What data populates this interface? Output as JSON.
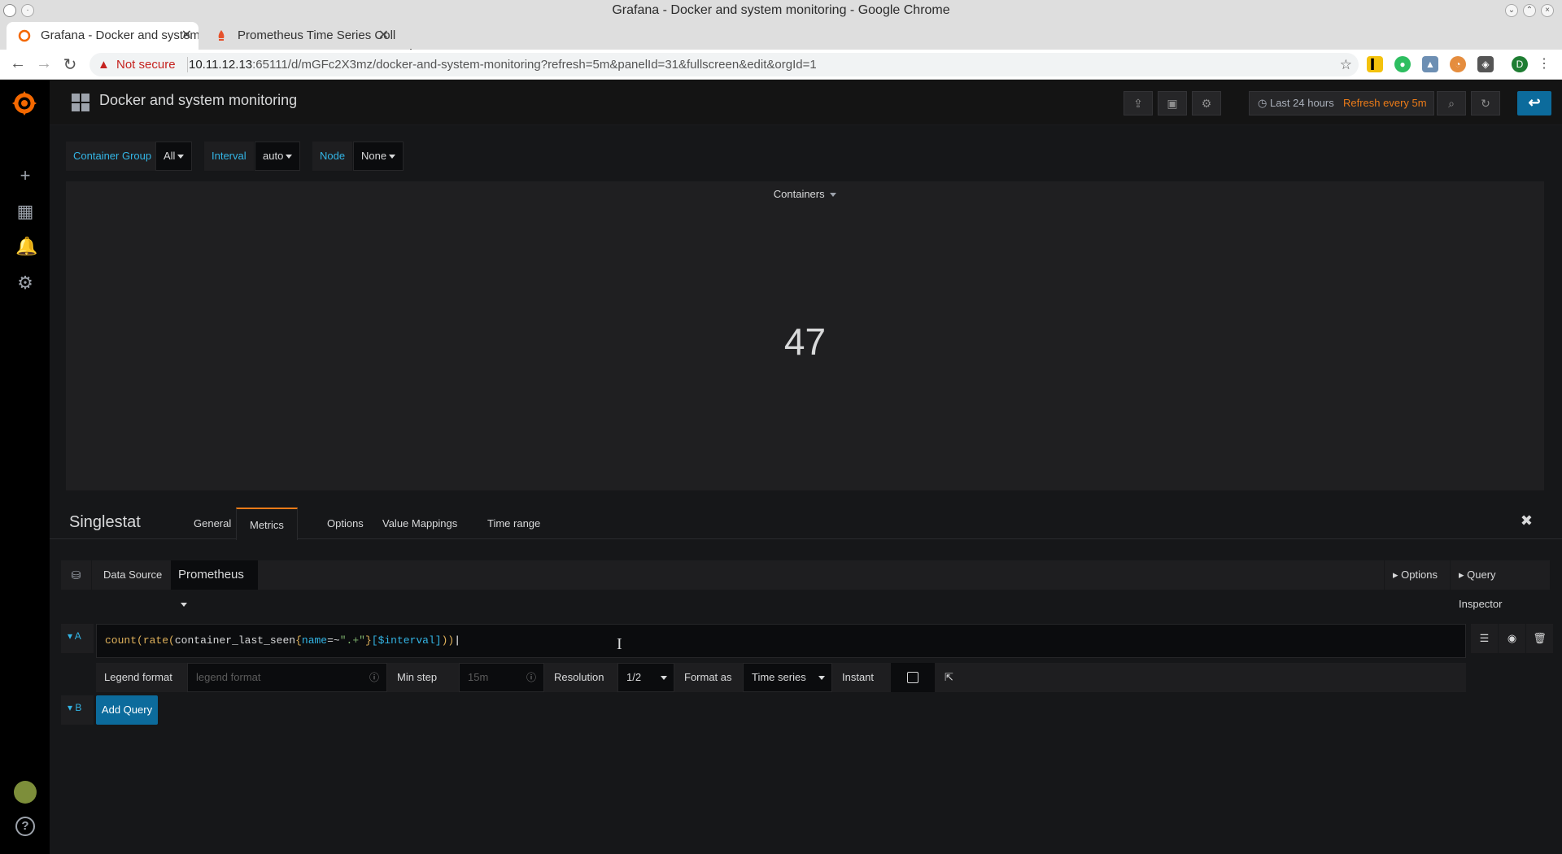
{
  "window": {
    "title": "Grafana - Docker and system monitoring - Google Chrome"
  },
  "browser": {
    "tabs": [
      {
        "title": "Grafana - Docker and system monitoring",
        "active": true,
        "icon": "grafana-icon"
      },
      {
        "title": "Prometheus Time Series Collection",
        "active": false,
        "icon": "prometheus-icon"
      }
    ],
    "security_label": "Not secure",
    "url_host": "10.11.12.13",
    "url_rest": ":65111/d/mGFc2X3mz/docker-and-system-monitoring?refresh=5m&panelId=31&fullscreen&edit&orgId=1",
    "profile_initial": "D"
  },
  "dashboard": {
    "title": "Docker and system monitoring",
    "time_range": "Last 24 hours",
    "refresh": "Refresh every 5m"
  },
  "variables": [
    {
      "label": "Container Group",
      "value": "All"
    },
    {
      "label": "Interval",
      "value": "auto"
    },
    {
      "label": "Node",
      "value": "None"
    }
  ],
  "panel": {
    "title": "Containers",
    "value": "47"
  },
  "editor": {
    "title": "Singlestat",
    "tabs": [
      "General",
      "Metrics",
      "Options",
      "Value Mappings",
      "Time range"
    ],
    "active_tab": "Metrics",
    "data_source_label": "Data Source",
    "data_source": "Prometheus",
    "options_btn": "Options",
    "query_inspector_btn": "Query Inspector",
    "query": {
      "letter": "A",
      "expr_parts": [
        "count",
        "(",
        "rate",
        "(",
        "container_last_seen",
        "{",
        "name",
        "=~",
        "\".+\"",
        "}",
        "[$interval]",
        ")",
        ")"
      ],
      "legend_format_label": "Legend format",
      "legend_format_placeholder": "legend format",
      "min_step_label": "Min step",
      "min_step_placeholder": "15m",
      "resolution_label": "Resolution",
      "resolution": "1/2",
      "format_as_label": "Format as",
      "format_as": "Time series",
      "instant_label": "Instant"
    },
    "next_letter": "B",
    "add_query": "Add Query"
  },
  "colors": {
    "accent": "#eb7b18",
    "link": "#33b5e5",
    "primary": "#0c6b9c"
  }
}
